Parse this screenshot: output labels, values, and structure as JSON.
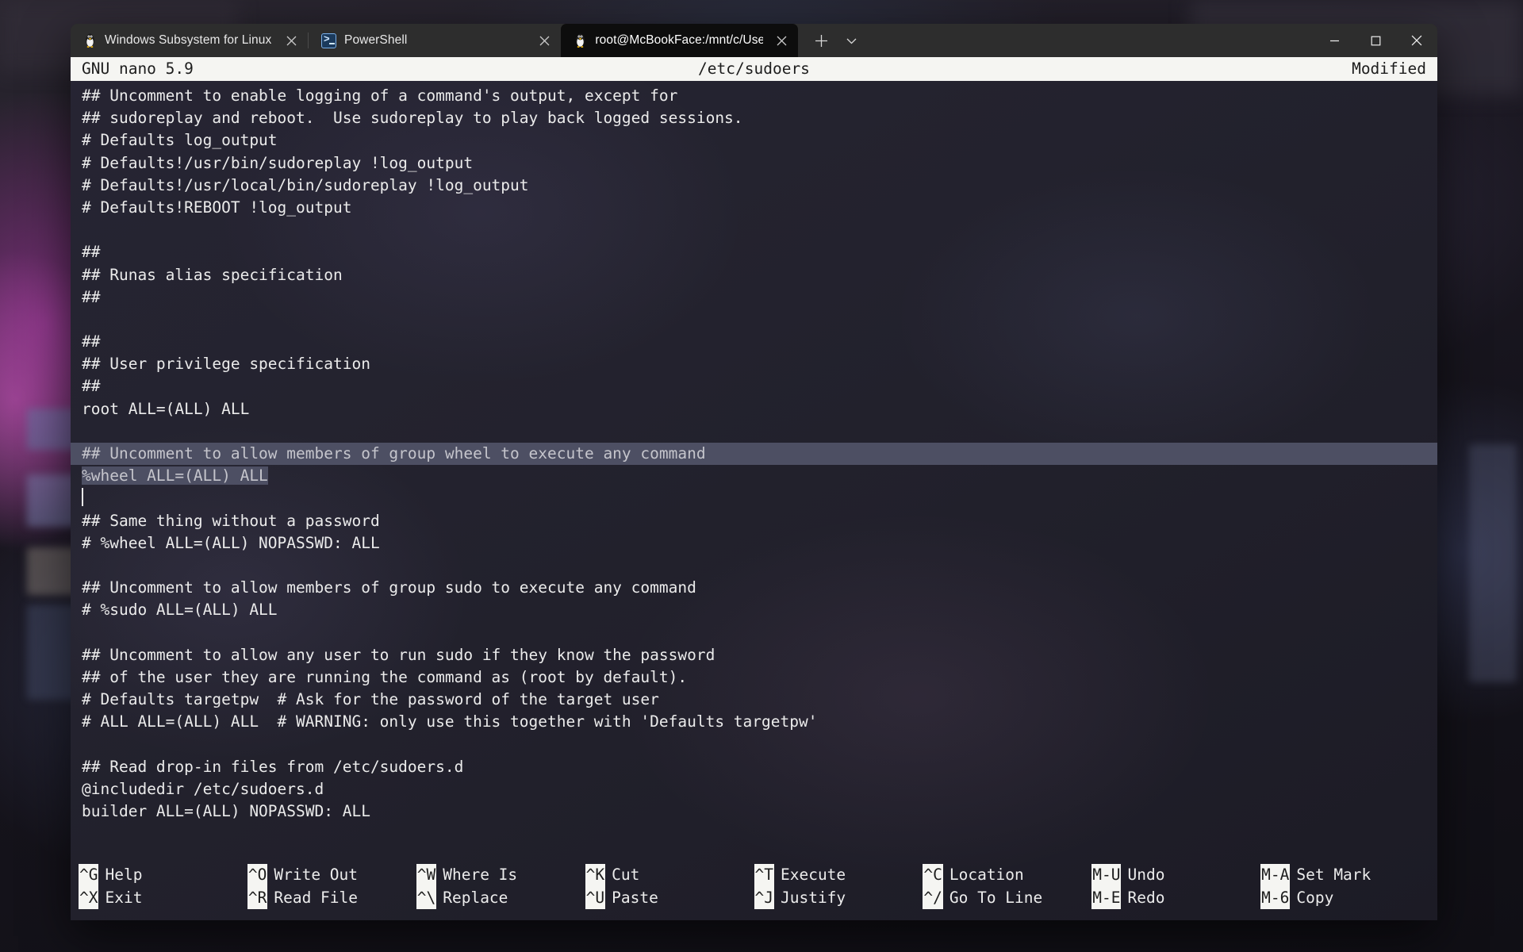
{
  "window": {
    "new_tab_icon": "plus-icon",
    "tab_dropdown_icon": "chevron-down-icon",
    "minimize_label": "—",
    "maximize_label": "☐",
    "close_label": "✕"
  },
  "tabs": [
    {
      "title": "Windows Subsystem for Linux P",
      "icon": "tux-icon",
      "active": false
    },
    {
      "title": "PowerShell",
      "icon": "powershell-icon",
      "active": false
    },
    {
      "title": "root@McBookFace:/mnt/c/User",
      "icon": "tux-icon",
      "active": true
    }
  ],
  "nano": {
    "title_left": "GNU nano 5.9",
    "title_center": "/etc/sudoers",
    "title_right": "Modified",
    "lines": [
      {
        "text": "## Uncomment to enable logging of a command's output, except for"
      },
      {
        "text": "## sudoreplay and reboot.  Use sudoreplay to play back logged sessions."
      },
      {
        "text": "# Defaults log_output"
      },
      {
        "text": "# Defaults!/usr/bin/sudoreplay !log_output"
      },
      {
        "text": "# Defaults!/usr/local/bin/sudoreplay !log_output"
      },
      {
        "text": "# Defaults!REBOOT !log_output"
      },
      {
        "text": ""
      },
      {
        "text": "##"
      },
      {
        "text": "## Runas alias specification"
      },
      {
        "text": "##"
      },
      {
        "text": ""
      },
      {
        "text": "##"
      },
      {
        "text": "## User privilege specification"
      },
      {
        "text": "##"
      },
      {
        "text": "root ALL=(ALL) ALL"
      },
      {
        "text": ""
      },
      {
        "text": "## Uncomment to allow members of group wheel to execute any command",
        "selected": "full"
      },
      {
        "text": "%wheel ALL=(ALL) ALL",
        "selected": "text"
      },
      {
        "text": "",
        "cursor": true
      },
      {
        "text": "## Same thing without a password"
      },
      {
        "text": "# %wheel ALL=(ALL) NOPASSWD: ALL"
      },
      {
        "text": ""
      },
      {
        "text": "## Uncomment to allow members of group sudo to execute any command"
      },
      {
        "text": "# %sudo ALL=(ALL) ALL"
      },
      {
        "text": ""
      },
      {
        "text": "## Uncomment to allow any user to run sudo if they know the password"
      },
      {
        "text": "## of the user they are running the command as (root by default)."
      },
      {
        "text": "# Defaults targetpw  # Ask for the password of the target user"
      },
      {
        "text": "# ALL ALL=(ALL) ALL  # WARNING: only use this together with 'Defaults targetpw'"
      },
      {
        "text": ""
      },
      {
        "text": "## Read drop-in files from /etc/sudoers.d"
      },
      {
        "text": "@includedir /etc/sudoers.d"
      },
      {
        "text": "builder ALL=(ALL) NOPASSWD: ALL"
      }
    ],
    "help": [
      {
        "key": "^G",
        "label": "Help",
        "key2": "^X",
        "label2": "Exit"
      },
      {
        "key": "^O",
        "label": "Write Out",
        "key2": "^R",
        "label2": "Read File"
      },
      {
        "key": "^W",
        "label": "Where Is",
        "key2": "^\\",
        "label2": "Replace"
      },
      {
        "key": "^K",
        "label": "Cut",
        "key2": "^U",
        "label2": "Paste"
      },
      {
        "key": "^T",
        "label": "Execute",
        "key2": "^J",
        "label2": "Justify"
      },
      {
        "key": "^C",
        "label": "Location",
        "key2": "^/",
        "label2": "Go To Line"
      },
      {
        "key": "M-U",
        "label": "Undo",
        "key2": "M-E",
        "label2": "Redo"
      },
      {
        "key": "M-A",
        "label": "Set Mark",
        "key2": "M-6",
        "label2": "Copy"
      }
    ]
  },
  "colors": {
    "nano_titlebar_bg": "#f5f5f2",
    "nano_titlebar_fg": "#1d1d1d",
    "selection_bg": "#4d4f63",
    "terminal_fg": "#ebebeb",
    "active_tab_bg": "#0d0d0d",
    "tabbar_bg": "#2d2d2d"
  }
}
